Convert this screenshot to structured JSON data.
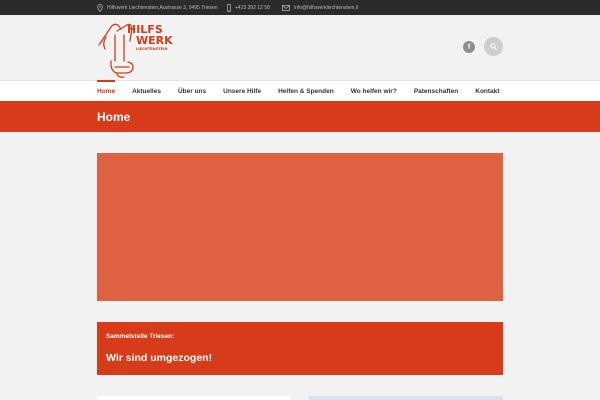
{
  "topbar": {
    "address": "Hilfswerk Liechtenstein,Austrasse 3, 9495 Triesen",
    "phone": "+423 392 12 58",
    "email": "info@hilfswerkliechtenstein.li"
  },
  "logo": {
    "line1": "HILFS",
    "line2": "WERK",
    "line3": "LIECHTENSTEIN"
  },
  "social": {
    "facebook_glyph": "f"
  },
  "nav": {
    "items": [
      {
        "label": "Home",
        "active": true
      },
      {
        "label": "Aktuelles"
      },
      {
        "label": "Über uns"
      },
      {
        "label": "Unsere Hilfe"
      },
      {
        "label": "Helfen & Spenden"
      },
      {
        "label": "Wo helfen wir?"
      },
      {
        "label": "Patenschaften"
      },
      {
        "label": "Kontakt"
      }
    ]
  },
  "page": {
    "title": "Home"
  },
  "notice": {
    "label": "Sammelstelle Triesen:",
    "headline": "Wir sind umgezogen!"
  },
  "colors": {
    "accent": "#d63c1a",
    "hero": "#de6242",
    "topbar": "#2b2b2b"
  }
}
